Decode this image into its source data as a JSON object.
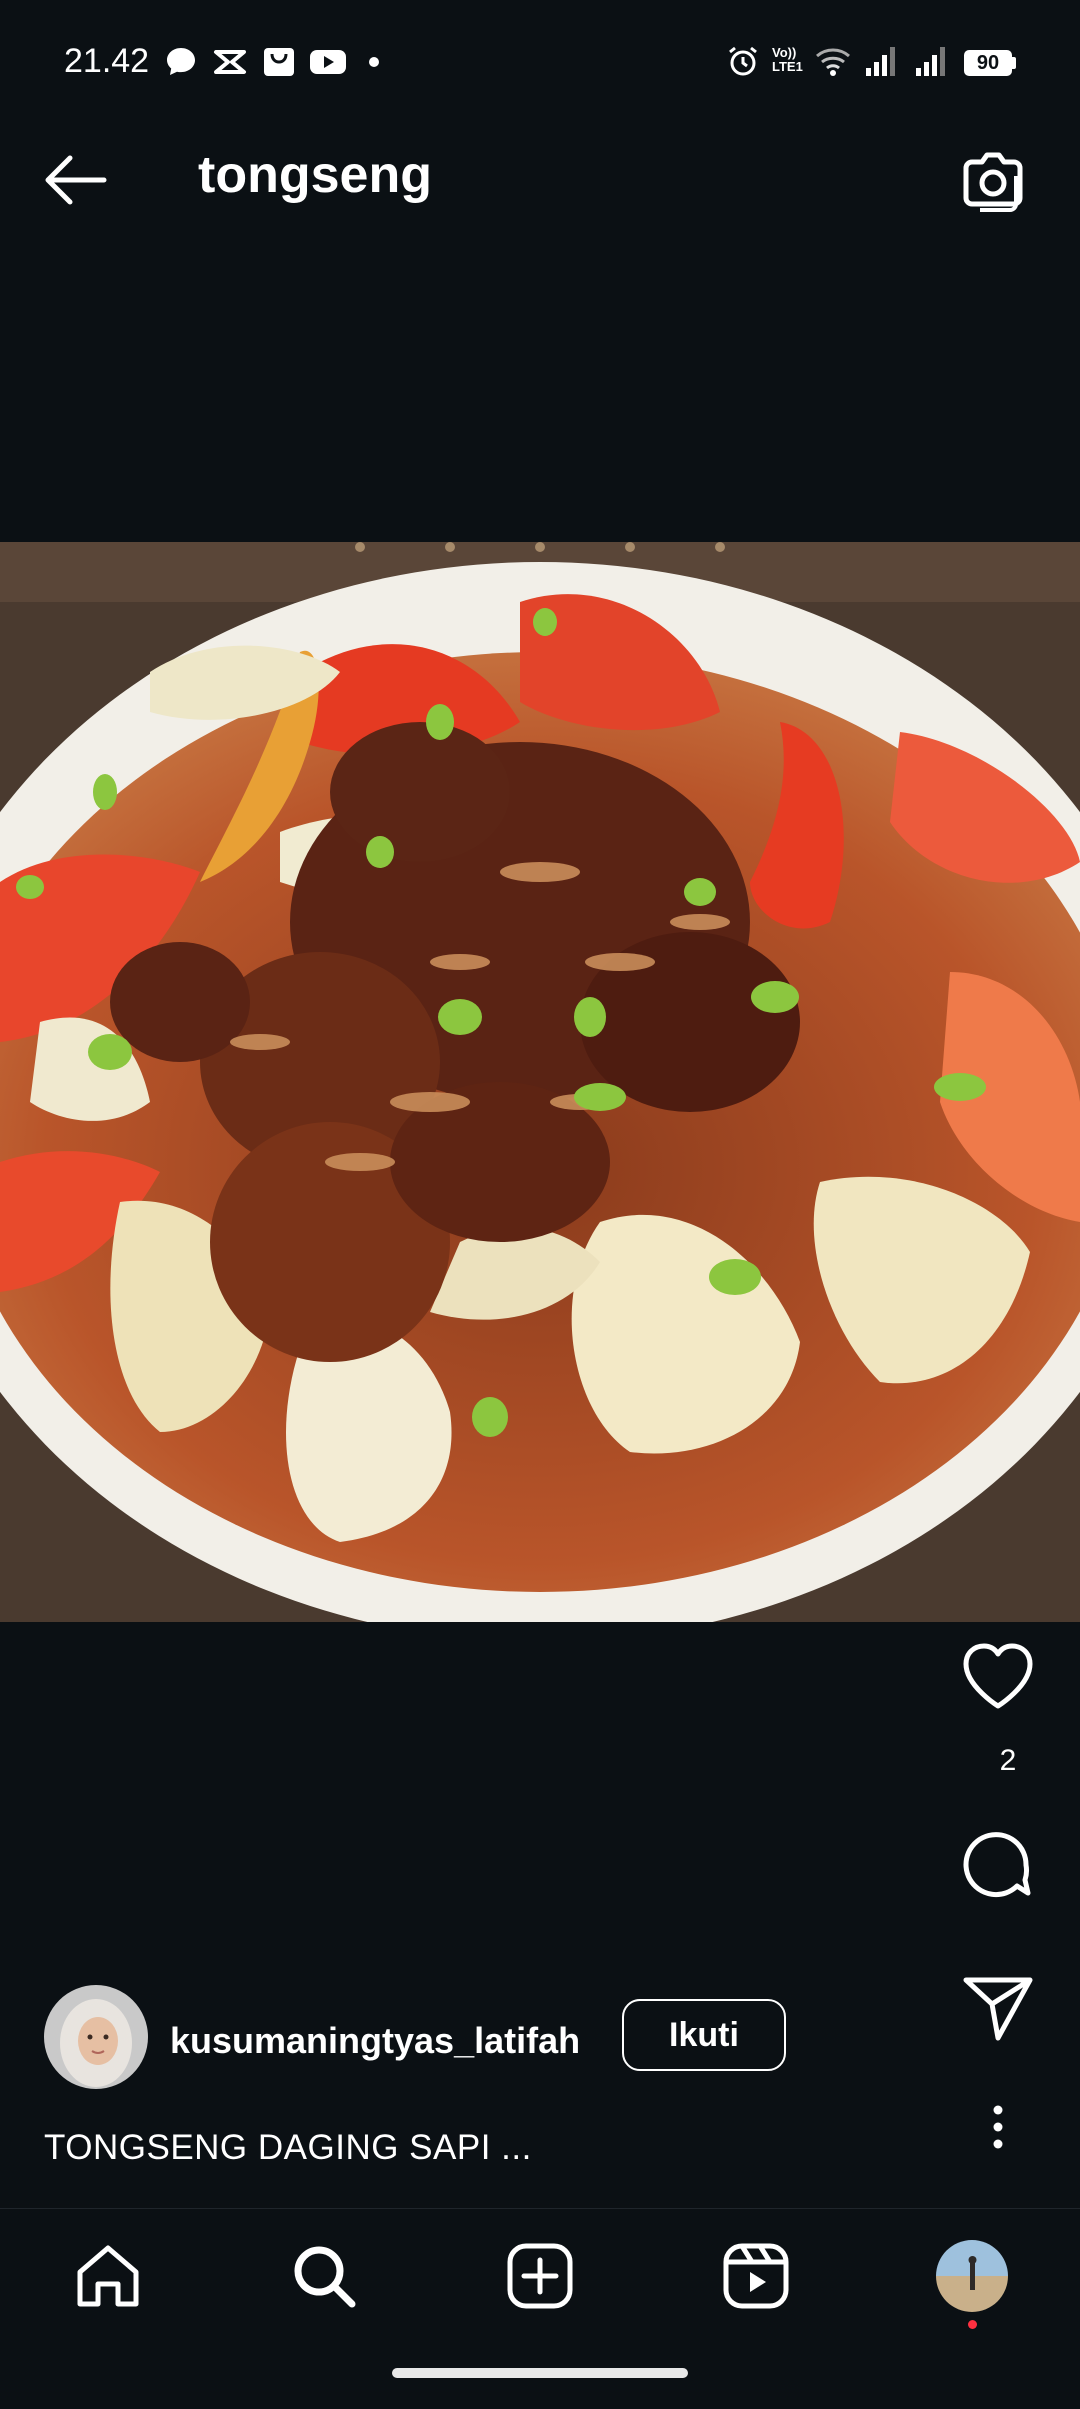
{
  "status_bar": {
    "time": "21.42",
    "battery": "90",
    "network_label": "Vo)) LTE1",
    "left_icons": [
      "message-bubble-icon",
      "capcut-icon",
      "shopping-bag-icon",
      "youtube-icon",
      "dot-icon"
    ],
    "right_icons": [
      "alarm-icon",
      "volte-icon",
      "wifi-icon",
      "signal-icon",
      "signal-icon",
      "battery-icon"
    ]
  },
  "header": {
    "title": "tongseng",
    "back_icon": "arrow-left-icon",
    "camera_icon": "camera-icon"
  },
  "post": {
    "like_count": "2",
    "author": "kusumaningtyas_latifah",
    "follow_label": "Ikuti",
    "caption": "TONGSENG DAGING SAPI ..."
  },
  "nav": {
    "items": [
      "home-icon",
      "search-icon",
      "create-icon",
      "reels-icon",
      "profile-avatar"
    ]
  },
  "colors": {
    "background": "#0b1014",
    "text": "#ffffff",
    "notification_dot": "#ff3040"
  }
}
